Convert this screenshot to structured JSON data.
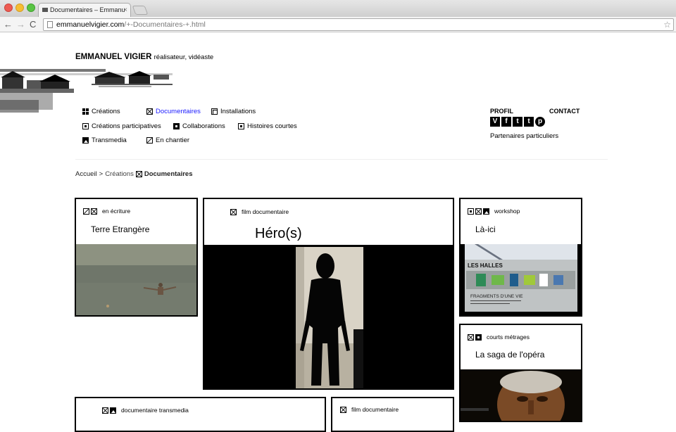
{
  "browser": {
    "tab_title": "Documentaires – Emmanu",
    "tab_close": "×",
    "url_host": "emmanuelvigier.com",
    "url_path": "/+-Documentaires-+.html",
    "nav_back": "←",
    "nav_forward": "→",
    "nav_reload": "C",
    "bookmark_star": "☆"
  },
  "site": {
    "name": "EMMANUEL VIGIER",
    "tagline": "réalisateur, vidéaste"
  },
  "menu": [
    {
      "label": "Créations",
      "icon": "grid-icon"
    },
    {
      "label": "Documentaires",
      "icon": "crossed-square-icon",
      "active": true
    },
    {
      "label": "Installations",
      "icon": "inner-square-icon"
    },
    {
      "label": "Créations participatives",
      "icon": "dot-square-icon"
    },
    {
      "label": "Collaborations",
      "icon": "filled-square-icon"
    },
    {
      "label": "Histoires courtes",
      "icon": "dot-square-icon"
    },
    {
      "label": "Transmedia",
      "icon": "mountain-icon"
    },
    {
      "label": "En chantier",
      "icon": "slash-square-icon"
    }
  ],
  "side": {
    "profil": "PROFIL",
    "contact": "CONTACT",
    "social": [
      "V",
      "f",
      "t",
      "t",
      "p"
    ],
    "partners": "Partenaires particuliers"
  },
  "breadcrumb": {
    "home": "Accueil",
    "sep": ">",
    "section": "Créations",
    "current": "Documentaires"
  },
  "cards": [
    {
      "tag": "en écriture",
      "title": "Terre Etrangère"
    },
    {
      "tag": "film documentaire",
      "title": "Héro(s)"
    },
    {
      "tag": "workshop",
      "title": "Là-ici",
      "poster_text": "LES HALLES",
      "poster_sub": "FRAGMENTS D'UNE VIE"
    },
    {
      "tag": "courts métrages",
      "title": "La saga de l'opéra"
    },
    {
      "tag": "documentaire transmedia",
      "title": ""
    },
    {
      "tag": "film documentaire",
      "title": ""
    }
  ]
}
